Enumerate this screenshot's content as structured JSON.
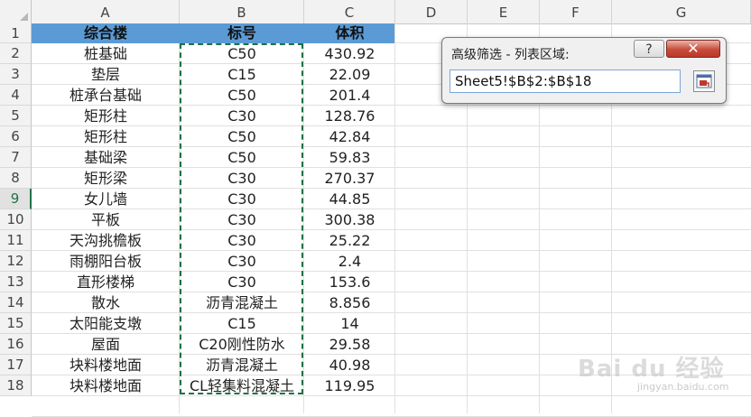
{
  "columns": [
    "A",
    "B",
    "C",
    "D",
    "E",
    "F",
    "G"
  ],
  "rows": [
    "1",
    "2",
    "3",
    "4",
    "5",
    "6",
    "7",
    "8",
    "9",
    "10",
    "11",
    "12",
    "13",
    "14",
    "15",
    "16",
    "17",
    "18"
  ],
  "active_row": "9",
  "table": {
    "headers": [
      "综合楼",
      "标号",
      "体积"
    ],
    "data": [
      [
        "桩基础",
        "C50",
        "430.92"
      ],
      [
        "垫层",
        "C15",
        "22.09"
      ],
      [
        "桩承台基础",
        "C50",
        "201.4"
      ],
      [
        "矩形柱",
        "C30",
        "128.76"
      ],
      [
        "矩形柱",
        "C50",
        "42.84"
      ],
      [
        "基础梁",
        "C50",
        "59.83"
      ],
      [
        "矩形梁",
        "C30",
        "270.37"
      ],
      [
        "女儿墙",
        "C30",
        "44.85"
      ],
      [
        "平板",
        "C30",
        "300.38"
      ],
      [
        "天沟挑檐板",
        "C30",
        "25.22"
      ],
      [
        "雨棚阳台板",
        "C30",
        "2.4"
      ],
      [
        "直形楼梯",
        "C30",
        "153.6"
      ],
      [
        "散水",
        "沥青混凝土",
        "8.856"
      ],
      [
        "太阳能支墩",
        "C15",
        "14"
      ],
      [
        "屋面",
        "C20刚性防水",
        "29.58"
      ],
      [
        "块料楼地面",
        "沥青混凝土",
        "40.98"
      ],
      [
        "块料楼地面",
        "CL轻集料混凝土",
        "119.95"
      ]
    ]
  },
  "dialog": {
    "title": "高级筛选 - 列表区域:",
    "help_label": "?",
    "close_label": "✕",
    "range_value": "Sheet5!$B$2:$B$18"
  },
  "watermark": {
    "text": "Bai du 经验",
    "sub": "jingyan.baidu.com"
  },
  "colors": {
    "header_band": "#5b9bd5",
    "marquee": "#1e7145",
    "active_row": "#217346"
  }
}
